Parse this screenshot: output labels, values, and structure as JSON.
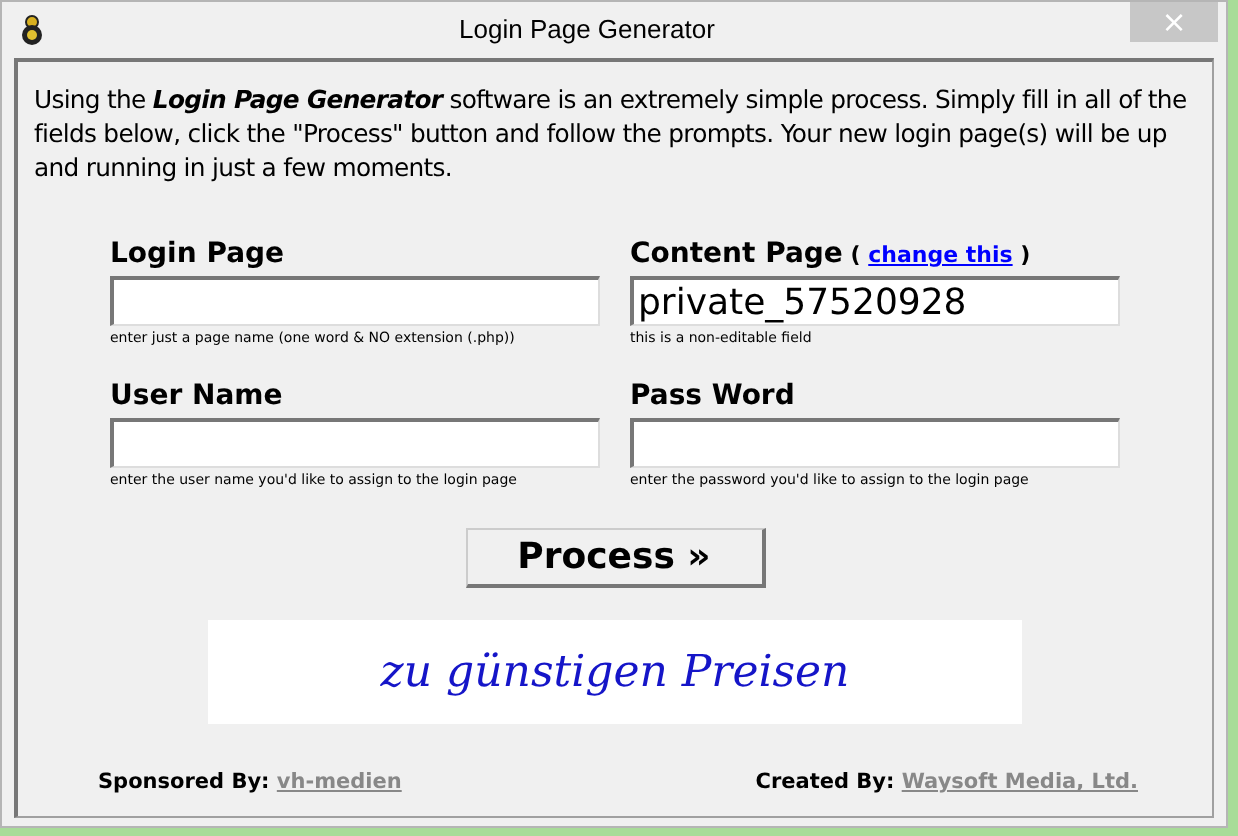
{
  "window": {
    "title": "Login Page Generator",
    "close": "×"
  },
  "intro": "Using the **Login Page Generator** software is an extremely simple process. Simply fill in all of the fields below, click the \"Process\" button and follow the prompts. Your new login page(s) will be up and running in just a few moments.",
  "fields": [
    {
      "label": "Login Page",
      "hint": "enter just a page name (one word & NO extension (.php))"
    },
    {
      "label": "Content Page",
      "link_open": "(",
      "link": "change this",
      "link_close": ")",
      "value": "private_57520928",
      "hint": "this is a non-editable field"
    },
    {
      "label": "User Name",
      "hint": "enter the user name you'd like to assign to the login page"
    },
    {
      "label": "Pass Word",
      "hint": "enter the password you'd like to assign to the login page"
    }
  ],
  "process_button": "Process »",
  "banner": "zu günstigen Preisen",
  "footer": {
    "sponsored_label": "Sponsored By:",
    "sponsor": "vh-medien",
    "created_label": "Created By:",
    "creator": "Waysoft Media, Ltd."
  }
}
